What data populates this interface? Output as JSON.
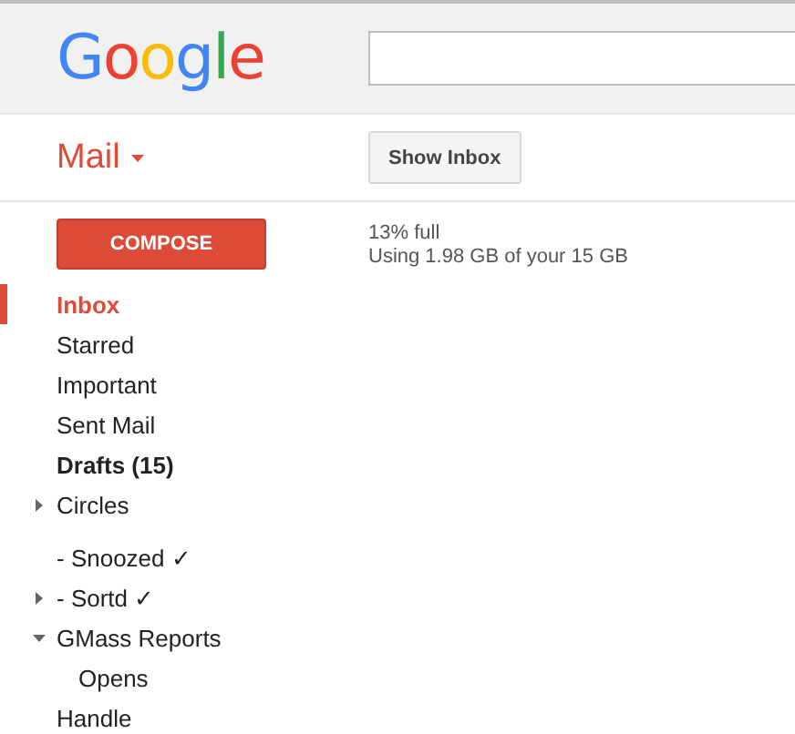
{
  "logo": {
    "text": "Google"
  },
  "app_menu": {
    "label": "Mail"
  },
  "toolbar": {
    "button": "Show Inbox"
  },
  "compose": {
    "label": "COMPOSE"
  },
  "storage": {
    "percent": "13% full",
    "usage": "Using 1.98 GB of your 15 GB"
  },
  "nav": {
    "items": [
      {
        "label": "Inbox",
        "selected": true,
        "unread": true
      },
      {
        "label": "Starred",
        "selected": false,
        "unread": false
      },
      {
        "label": "Important",
        "selected": false,
        "unread": false
      },
      {
        "label": "Sent Mail",
        "selected": false,
        "unread": false
      },
      {
        "label": "Drafts (15)",
        "selected": false,
        "unread": true
      },
      {
        "label": "Circles",
        "selected": false,
        "unread": false,
        "expanded": false
      }
    ]
  },
  "labels": {
    "items": [
      {
        "label": "- Snoozed ✓",
        "selected": false,
        "unread": false
      },
      {
        "label": "- Sortd ✓",
        "selected": false,
        "unread": false,
        "expanded": false
      },
      {
        "label": "GMass Reports",
        "selected": false,
        "unread": false,
        "expanded": true,
        "children": [
          {
            "label": "Opens",
            "selected": false,
            "unread": false
          }
        ]
      },
      {
        "label": "Handle",
        "selected": false,
        "unread": false
      }
    ]
  }
}
